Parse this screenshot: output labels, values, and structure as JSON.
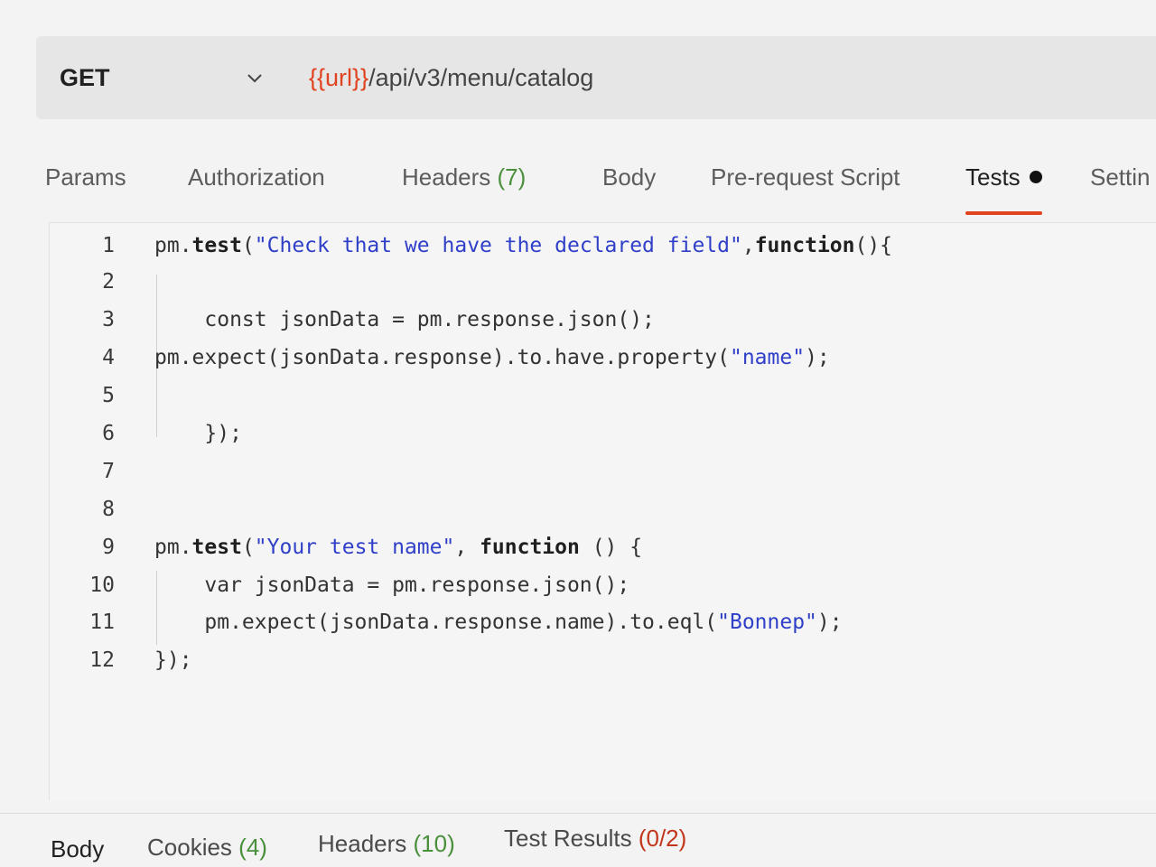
{
  "request": {
    "method": "GET",
    "url_variable": "{{url}}",
    "url_path": "/api/v3/menu/catalog"
  },
  "tabs": {
    "params": "Params",
    "authorization": "Authorization",
    "headers": "Headers",
    "headers_count": "(7)",
    "body": "Body",
    "pre_request": "Pre-request Script",
    "tests": "Tests",
    "settings": "Settin"
  },
  "editor": {
    "lines": [
      {
        "n": "1",
        "parts": [
          [
            "plain",
            "pm."
          ],
          [
            "kw",
            "test"
          ],
          [
            "plain",
            "("
          ],
          [
            "str",
            "\"Check that we have the declared field\""
          ],
          [
            "plain",
            ","
          ],
          [
            "kw",
            "function"
          ],
          [
            "plain",
            "(){"
          ]
        ]
      },
      {
        "n": "2",
        "parts": []
      },
      {
        "n": "3",
        "parts": [
          [
            "plain",
            "    const jsonData = pm.response.json();"
          ]
        ]
      },
      {
        "n": "4",
        "parts": [
          [
            "plain",
            "pm.expect(jsonData.response).to.have.property("
          ],
          [
            "str",
            "\"name\""
          ],
          [
            "plain",
            ");"
          ]
        ]
      },
      {
        "n": "5",
        "parts": []
      },
      {
        "n": "6",
        "parts": [
          [
            "plain",
            "    });"
          ]
        ]
      },
      {
        "n": "7",
        "parts": []
      },
      {
        "n": "8",
        "parts": []
      },
      {
        "n": "9",
        "parts": [
          [
            "plain",
            "pm."
          ],
          [
            "kw",
            "test"
          ],
          [
            "plain",
            "("
          ],
          [
            "str",
            "\"Your test name\""
          ],
          [
            "plain",
            ", "
          ],
          [
            "kw",
            "function"
          ],
          [
            "plain",
            " () {"
          ]
        ]
      },
      {
        "n": "10",
        "parts": [
          [
            "plain",
            "    var jsonData = pm.response.json();"
          ]
        ]
      },
      {
        "n": "11",
        "parts": [
          [
            "plain",
            "    pm.expect(jsonData.response.name).to.eql("
          ],
          [
            "str",
            "\"Bonnep\""
          ],
          [
            "plain",
            ");"
          ]
        ]
      },
      {
        "n": "12",
        "parts": [
          [
            "plain",
            "});"
          ]
        ]
      }
    ]
  },
  "response_tabs": {
    "body": "Body",
    "cookies": "Cookies",
    "cookies_count": "(4)",
    "headers": "Headers",
    "headers_count": "(10)",
    "test_results": "Test Results",
    "test_results_count": "(0/2)"
  },
  "colors": {
    "accent": "#e0431f",
    "string": "#2f3fc8",
    "count": "#4a8f3c"
  },
  "icons": {
    "method_dropdown": "chevron-down-icon",
    "tests_indicator": "dot-icon"
  }
}
